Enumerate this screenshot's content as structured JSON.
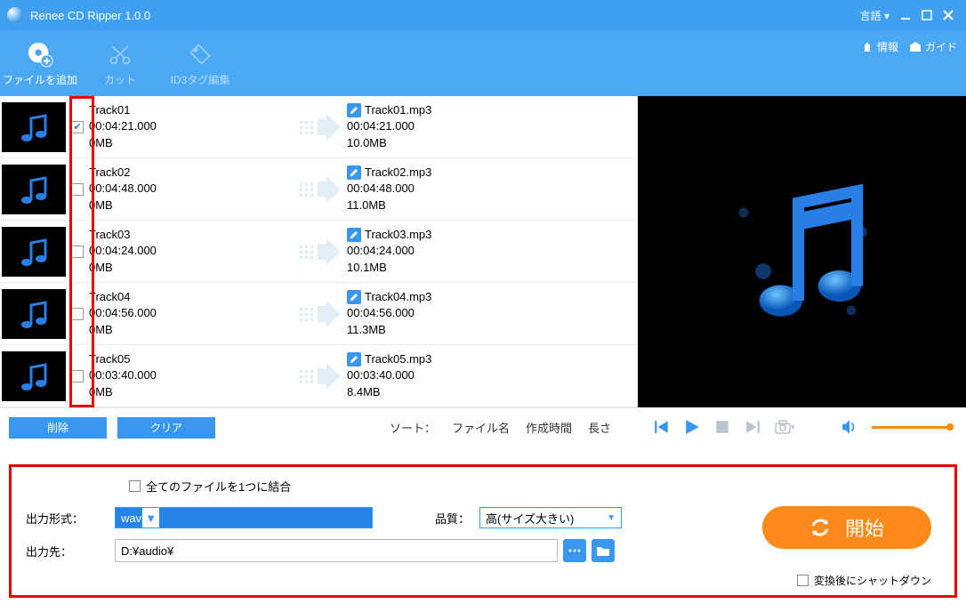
{
  "app": {
    "title": "Renee CD Ripper 1.0.0",
    "language_label": "言語"
  },
  "toolbar": {
    "add_files": "ファイルを追加",
    "cut": "カット",
    "id3": "ID3タグ編集",
    "info_label": "情報",
    "guide_label": "ガイド"
  },
  "tracks": [
    {
      "checked": true,
      "name": "Track01",
      "duration": "00:04:21.000",
      "src_size": "0MB",
      "out_name": "Track01.mp3",
      "out_duration": "00:04:21.000",
      "out_size": "10.0MB"
    },
    {
      "checked": false,
      "name": "Track02",
      "duration": "00:04:48.000",
      "src_size": "0MB",
      "out_name": "Track02.mp3",
      "out_duration": "00:04:48.000",
      "out_size": "11.0MB"
    },
    {
      "checked": false,
      "name": "Track03",
      "duration": "00:04:24.000",
      "src_size": "0MB",
      "out_name": "Track03.mp3",
      "out_duration": "00:04:24.000",
      "out_size": "10.1MB"
    },
    {
      "checked": false,
      "name": "Track04",
      "duration": "00:04:56.000",
      "src_size": "0MB",
      "out_name": "Track04.mp3",
      "out_duration": "00:04:56.000",
      "out_size": "11.3MB"
    },
    {
      "checked": false,
      "name": "Track05",
      "duration": "00:03:40.000",
      "src_size": "0MB",
      "out_name": "Track05.mp3",
      "out_duration": "00:03:40.000",
      "out_size": "8.4MB"
    }
  ],
  "buttons": {
    "delete": "削除",
    "clear": "クリア"
  },
  "sort": {
    "label": "ソート：",
    "opt1": "ファイル名",
    "opt2": "作成時間",
    "opt3": "長さ"
  },
  "settings": {
    "merge_label": "全てのファイルを1つに結合",
    "format_label": "出力形式：",
    "format_value": "wav",
    "quality_label": "品質：",
    "quality_value": "高(サイズ大きい)",
    "output_label": "出力先：",
    "output_value": "D:¥audio¥",
    "start_label": "開始",
    "shutdown_label": "変換後にシャットダウン"
  }
}
